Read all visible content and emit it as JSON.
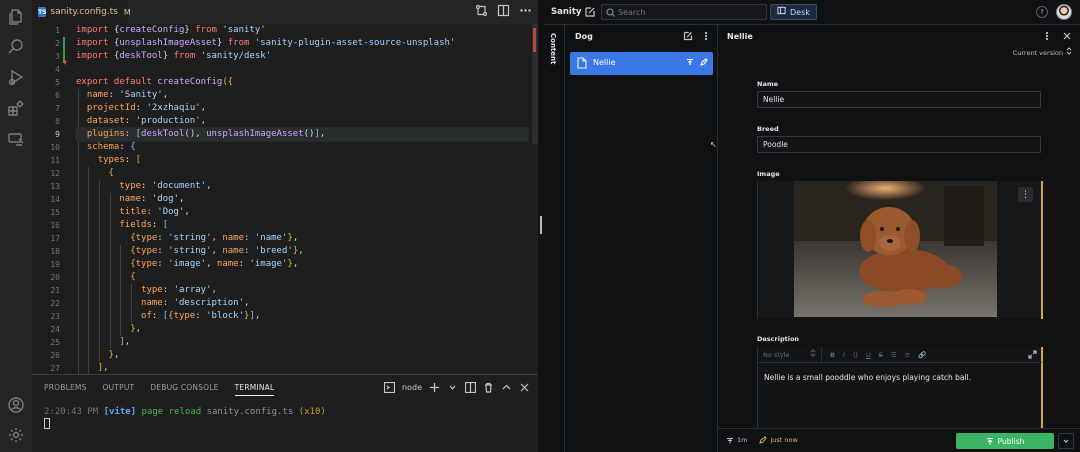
{
  "vscode": {
    "tab": {
      "filename": "sanity.config.ts",
      "badge": "TS",
      "modified": "M",
      "close": "×"
    },
    "line_numbers": [
      "1",
      "2",
      "3",
      "4",
      "5",
      "6",
      "7",
      "8",
      "9",
      "10",
      "11",
      "12",
      "13",
      "14",
      "15",
      "16",
      "17",
      "18",
      "19",
      "20",
      "21",
      "22",
      "23",
      "24",
      "25",
      "26",
      "27"
    ],
    "active_line": 9,
    "code_lines": [
      [
        [
          "k",
          "import "
        ],
        [
          "b",
          "{"
        ],
        [
          "f",
          "createConfig"
        ],
        [
          "b",
          "} "
        ],
        [
          "k",
          "from "
        ],
        [
          "s",
          "'sanity'"
        ]
      ],
      [
        [
          "k",
          "import "
        ],
        [
          "b",
          "{"
        ],
        [
          "f",
          "unsplashImageAsset"
        ],
        [
          "b",
          "} "
        ],
        [
          "k",
          "from "
        ],
        [
          "s",
          "'sanity-plugin-asset-source-unsplash'"
        ]
      ],
      [
        [
          "k",
          "import "
        ],
        [
          "b",
          "{"
        ],
        [
          "f",
          "deskTool"
        ],
        [
          "b",
          "} "
        ],
        [
          "k",
          "from "
        ],
        [
          "s",
          "'sanity/desk'"
        ]
      ],
      [],
      [
        [
          "k",
          "export default "
        ],
        [
          "f",
          "createConfig"
        ],
        [
          "y",
          "({"
        ]
      ],
      [
        [
          "b",
          "  "
        ],
        [
          "p",
          "name"
        ],
        [
          "b",
          ": "
        ],
        [
          "s",
          "'Sanity'"
        ],
        [
          "b",
          ","
        ]
      ],
      [
        [
          "b",
          "  "
        ],
        [
          "p",
          "projectId"
        ],
        [
          "b",
          ": "
        ],
        [
          "s",
          "'2xzhaqiu'"
        ],
        [
          "b",
          ","
        ]
      ],
      [
        [
          "b",
          "  "
        ],
        [
          "p",
          "dataset"
        ],
        [
          "b",
          ": "
        ],
        [
          "s",
          "'production'"
        ],
        [
          "b",
          ","
        ]
      ],
      [
        [
          "b",
          "  "
        ],
        [
          "p",
          "plugins"
        ],
        [
          "b",
          ": "
        ],
        [
          "v",
          "["
        ],
        [
          "f",
          "deskTool"
        ],
        [
          "b",
          "(), "
        ],
        [
          "f",
          "unsplashImageAsset"
        ],
        [
          "b",
          "()"
        ],
        [
          "v",
          "]"
        ],
        [
          "b",
          ","
        ]
      ],
      [
        [
          "b",
          "  "
        ],
        [
          "p",
          "schema"
        ],
        [
          "b",
          ": "
        ],
        [
          "v",
          "{"
        ]
      ],
      [
        [
          "b",
          "    "
        ],
        [
          "p",
          "types"
        ],
        [
          "b",
          ": "
        ],
        [
          "y",
          "["
        ]
      ],
      [
        [
          "b",
          "      "
        ],
        [
          "y",
          "{"
        ]
      ],
      [
        [
          "b",
          "        "
        ],
        [
          "p",
          "type"
        ],
        [
          "b",
          ": "
        ],
        [
          "s",
          "'document'"
        ],
        [
          "b",
          ","
        ]
      ],
      [
        [
          "b",
          "        "
        ],
        [
          "p",
          "name"
        ],
        [
          "b",
          ": "
        ],
        [
          "s",
          "'dog'"
        ],
        [
          "b",
          ","
        ]
      ],
      [
        [
          "b",
          "        "
        ],
        [
          "p",
          "title"
        ],
        [
          "b",
          ": "
        ],
        [
          "s",
          "'Dog'"
        ],
        [
          "b",
          ","
        ]
      ],
      [
        [
          "b",
          "        "
        ],
        [
          "p",
          "fields"
        ],
        [
          "b",
          ": "
        ],
        [
          "v",
          "["
        ]
      ],
      [
        [
          "b",
          "          "
        ],
        [
          "y",
          "{"
        ],
        [
          "p",
          "type"
        ],
        [
          "b",
          ": "
        ],
        [
          "s",
          "'string'"
        ],
        [
          "b",
          ", "
        ],
        [
          "p",
          "name"
        ],
        [
          "b",
          ": "
        ],
        [
          "s",
          "'name'"
        ],
        [
          "y",
          "}"
        ],
        [
          "b",
          ","
        ]
      ],
      [
        [
          "b",
          "          "
        ],
        [
          "y",
          "{"
        ],
        [
          "p",
          "type"
        ],
        [
          "b",
          ": "
        ],
        [
          "s",
          "'string'"
        ],
        [
          "b",
          ", "
        ],
        [
          "p",
          "name"
        ],
        [
          "b",
          ": "
        ],
        [
          "s",
          "'breed'"
        ],
        [
          "y",
          "}"
        ],
        [
          "b",
          ","
        ]
      ],
      [
        [
          "b",
          "          "
        ],
        [
          "y",
          "{"
        ],
        [
          "p",
          "type"
        ],
        [
          "b",
          ": "
        ],
        [
          "s",
          "'image'"
        ],
        [
          "b",
          ", "
        ],
        [
          "p",
          "name"
        ],
        [
          "b",
          ": "
        ],
        [
          "s",
          "'image'"
        ],
        [
          "y",
          "}"
        ],
        [
          "b",
          ","
        ]
      ],
      [
        [
          "b",
          "          "
        ],
        [
          "y",
          "{"
        ]
      ],
      [
        [
          "b",
          "            "
        ],
        [
          "p",
          "type"
        ],
        [
          "b",
          ": "
        ],
        [
          "s",
          "'array'"
        ],
        [
          "b",
          ","
        ]
      ],
      [
        [
          "b",
          "            "
        ],
        [
          "p",
          "name"
        ],
        [
          "b",
          ": "
        ],
        [
          "s",
          "'description'"
        ],
        [
          "b",
          ","
        ]
      ],
      [
        [
          "b",
          "            "
        ],
        [
          "p",
          "of"
        ],
        [
          "b",
          ": "
        ],
        [
          "v",
          "["
        ],
        [
          "y",
          "{"
        ],
        [
          "p",
          "type"
        ],
        [
          "b",
          ": "
        ],
        [
          "s",
          "'block'"
        ],
        [
          "y",
          "}"
        ],
        [
          "v",
          "]"
        ],
        [
          "b",
          ","
        ]
      ],
      [
        [
          "b",
          "          "
        ],
        [
          "y",
          "}"
        ],
        [
          "b",
          ","
        ]
      ],
      [
        [
          "b",
          "        "
        ],
        [
          "v",
          "]"
        ],
        [
          "b",
          ","
        ]
      ],
      [
        [
          "b",
          "      "
        ],
        [
          "y",
          "}"
        ],
        [
          "b",
          ","
        ]
      ],
      [
        [
          "b",
          "    "
        ],
        [
          "y",
          "]"
        ],
        [
          "b",
          ","
        ]
      ]
    ],
    "panel": {
      "tabs": [
        "PROBLEMS",
        "OUTPUT",
        "DEBUG CONSOLE",
        "TERMINAL"
      ],
      "active_tab": "TERMINAL",
      "terminal_name": "node",
      "terminal": {
        "time": "2:20:43 PM",
        "tag": "[vite]",
        "message": "page reload",
        "file": "sanity.config.ts",
        "count": "(x10)"
      }
    }
  },
  "sanity": {
    "brand": "Sanity",
    "search_placeholder": "Search",
    "desk_label": "Desk",
    "help_label": "?",
    "rail_label": "Content",
    "list": {
      "title": "Dog",
      "items": [
        {
          "label": "Nellie"
        }
      ]
    },
    "document": {
      "title": "Nellie",
      "version_label": "Current version",
      "fields": {
        "name": {
          "label": "Name",
          "value": "Nellie"
        },
        "breed": {
          "label": "Breed",
          "value": "Poodle"
        },
        "image": {
          "label": "Image",
          "menu": "⋮"
        },
        "description": {
          "label": "Description",
          "style_placeholder": "No style",
          "toolbar": [
            "B",
            "I",
            "⟨⟩",
            "U",
            "S",
            "☰",
            "≡",
            "🔗"
          ],
          "value": "Nellie is a small pooddle who enjoys playing catch ball."
        }
      },
      "footer": {
        "history": "1m",
        "saved": "just now",
        "publish_label": "Publish"
      }
    },
    "colors": {
      "accent_blue": "#3b78e7",
      "publish_green": "#3ab563",
      "changed_yellow": "#d9a53a"
    }
  }
}
